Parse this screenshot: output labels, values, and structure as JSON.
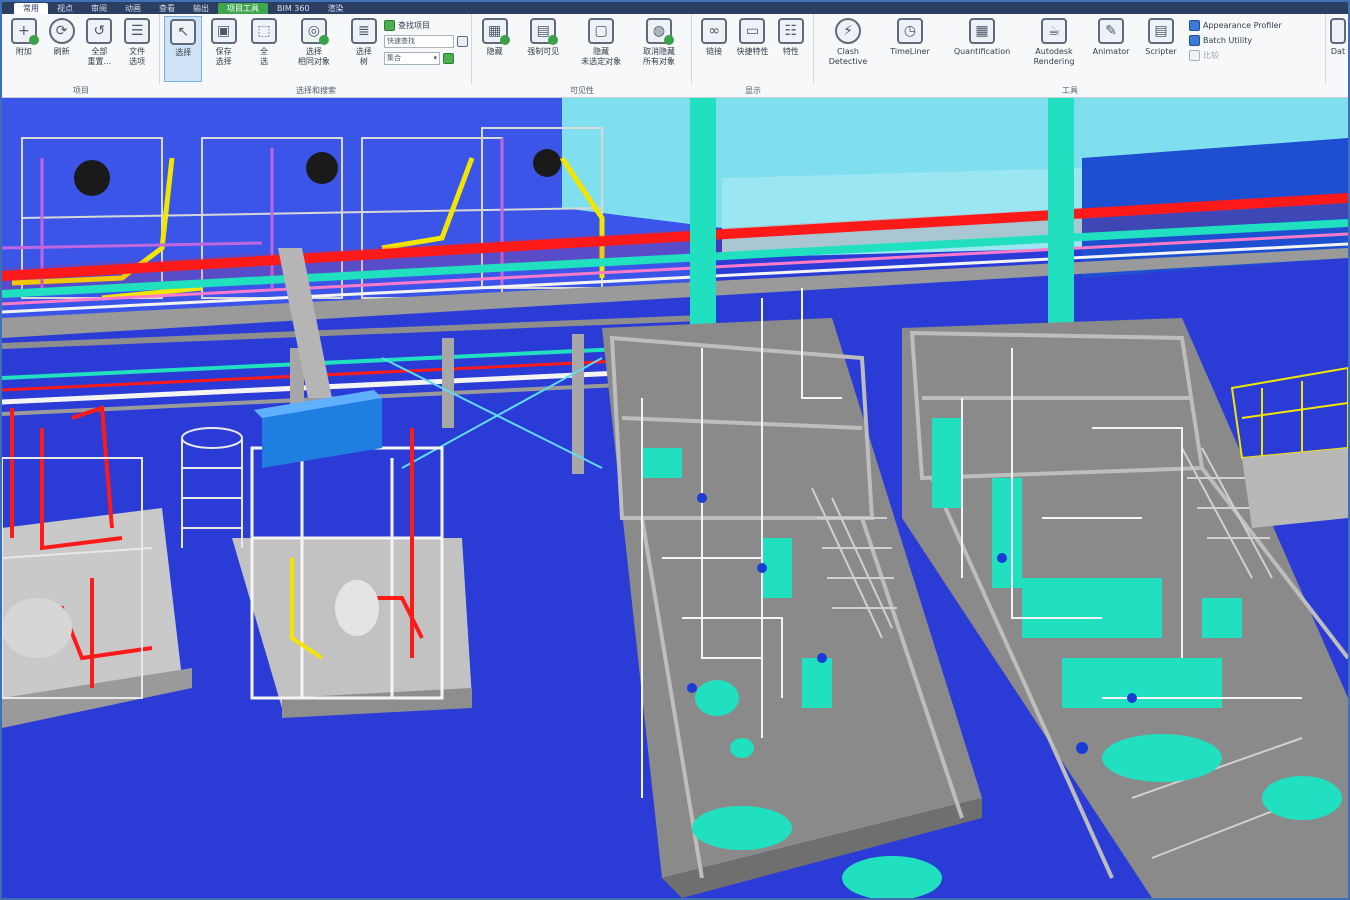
{
  "ribbon_tabs": [
    {
      "label": "常用",
      "active": true
    },
    {
      "label": "视点",
      "active": false
    },
    {
      "label": "审阅",
      "active": false
    },
    {
      "label": "动画",
      "active": false
    },
    {
      "label": "查看",
      "active": false
    },
    {
      "label": "输出",
      "active": false
    },
    {
      "label": "项目工具",
      "active": false,
      "contextual": true
    },
    {
      "label": "BIM 360",
      "active": false
    },
    {
      "label": "渲染",
      "active": false
    }
  ],
  "groups": {
    "project": {
      "label": "项目",
      "buttons": [
        {
          "label": "附加",
          "icon": "append-icon"
        },
        {
          "label": "刷新",
          "icon": "refresh-icon"
        },
        {
          "label": "全部\n重置...",
          "icon": "reset-all-icon"
        },
        {
          "label": "文件\n选项",
          "icon": "file-options-icon"
        }
      ]
    },
    "select_search": {
      "label": "选择和搜索",
      "buttons": [
        {
          "label": "选择",
          "icon": "select-cursor-icon",
          "selected": true
        },
        {
          "label": "保存\n选择",
          "icon": "save-selection-icon"
        },
        {
          "label": "全\n选",
          "icon": "select-all-icon"
        },
        {
          "label": "选择\n相同对象",
          "icon": "select-same-icon"
        },
        {
          "label": "选择\n树",
          "icon": "selection-tree-icon"
        }
      ],
      "find_items_label": "查找项目",
      "quick_find_placeholder": "快速查找",
      "sets_label": "集合"
    },
    "visibility": {
      "label": "可见性",
      "buttons": [
        {
          "label": "隐藏",
          "icon": "hide-icon"
        },
        {
          "label": "强制可见",
          "icon": "require-icon"
        },
        {
          "label": "隐藏\n未选定对象",
          "icon": "hide-unselected-icon"
        },
        {
          "label": "取消隐藏\n所有对象",
          "icon": "unhide-all-icon"
        }
      ]
    },
    "display": {
      "label": "显示",
      "buttons": [
        {
          "label": "链接",
          "icon": "links-icon"
        },
        {
          "label": "快捷特性",
          "icon": "quick-properties-icon"
        },
        {
          "label": "特性",
          "icon": "properties-icon"
        }
      ]
    },
    "tools": {
      "label": "工具",
      "buttons": [
        {
          "label": "Clash\nDetective",
          "icon": "clash-detective-icon"
        },
        {
          "label": "TimeLiner",
          "icon": "timeliner-icon"
        },
        {
          "label": "Quantification",
          "icon": "quantification-icon"
        },
        {
          "label": "Autodesk\nRendering",
          "icon": "rendering-icon"
        },
        {
          "label": "Animator",
          "icon": "animator-icon"
        },
        {
          "label": "Scripter",
          "icon": "scripter-icon"
        }
      ],
      "side_items": [
        {
          "label": "Appearance Profiler",
          "icon": "appearance-profiler-icon"
        },
        {
          "label": "Batch Utility",
          "icon": "batch-utility-icon"
        },
        {
          "label": "比较",
          "icon": "compare-icon"
        }
      ],
      "overflow_label": "Dat"
    }
  },
  "scene_colors": {
    "background": "#2b3bd6",
    "pipe_red": "#ff1a1a",
    "pipe_cyan": "#20e0c0",
    "steel_gray": "#8e8e8e",
    "pipe_yellow": "#f2e600",
    "pipe_white": "#f4f4f4",
    "equipment_blue": "#1f7fe0"
  }
}
